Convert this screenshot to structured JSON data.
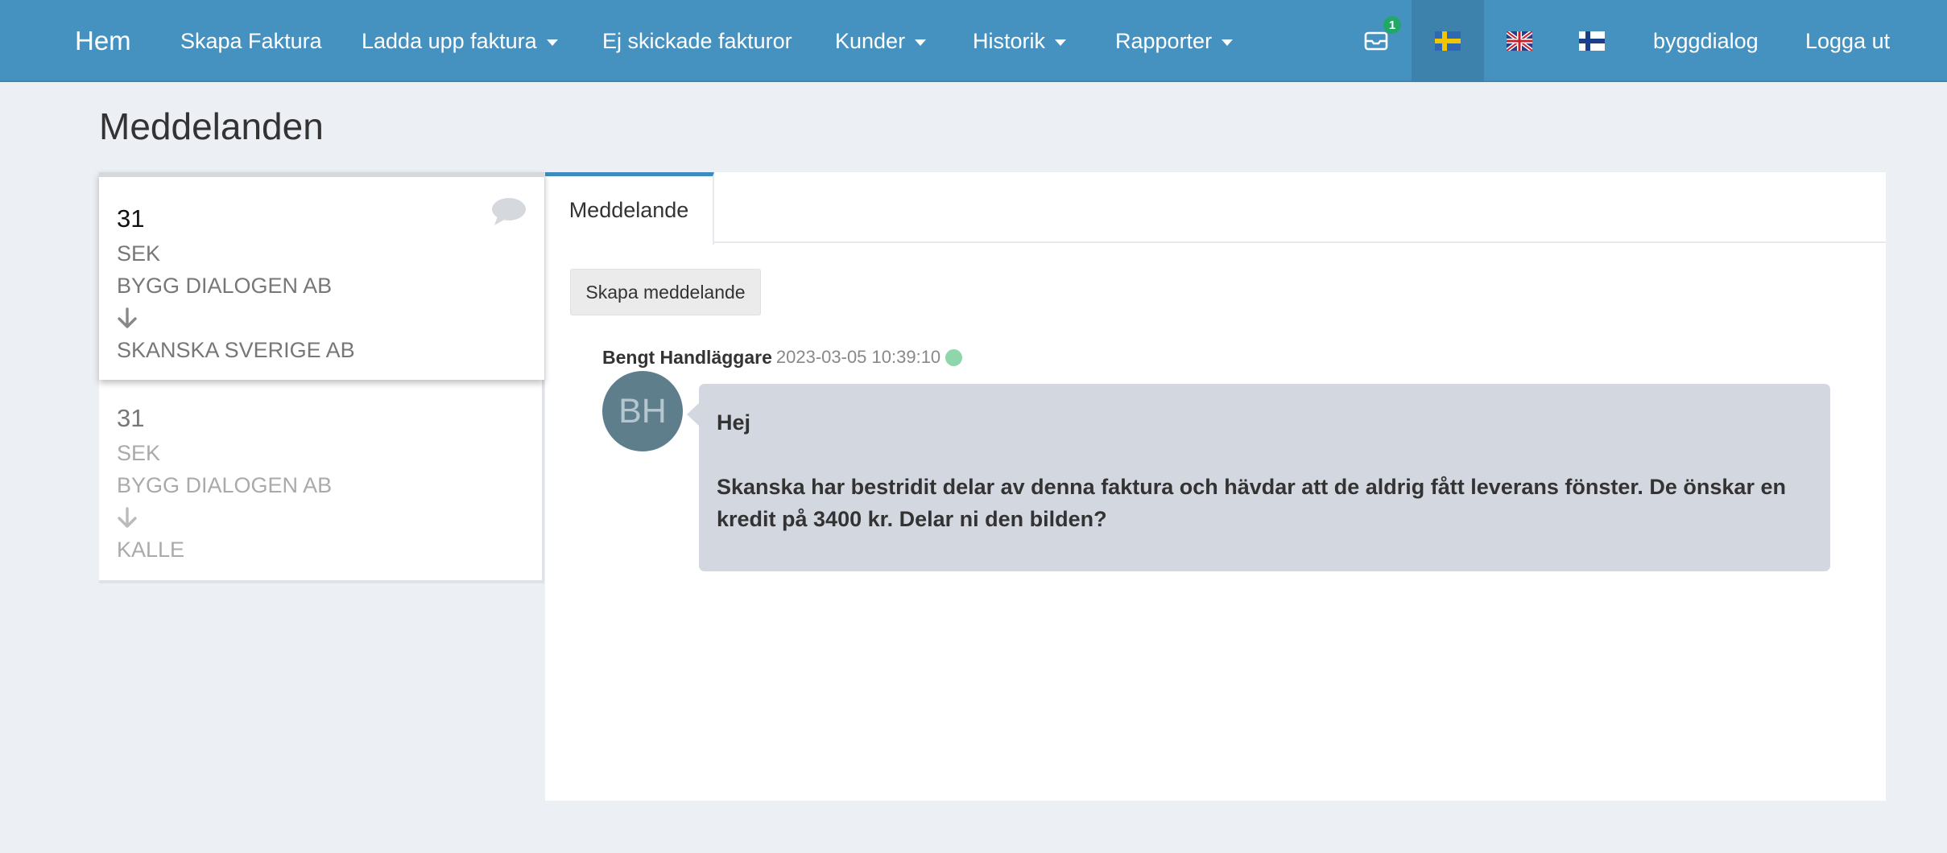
{
  "navbar": {
    "brand": "Hem",
    "items": [
      {
        "label": "Skapa Faktura",
        "dropdown": false
      },
      {
        "label": "Ladda upp faktura",
        "dropdown": true
      },
      {
        "label": "Ej skickade fakturor",
        "dropdown": false
      },
      {
        "label": "Kunder",
        "dropdown": true
      },
      {
        "label": "Historik",
        "dropdown": true
      },
      {
        "label": "Rapporter",
        "dropdown": true
      }
    ],
    "mail_badge_count": "1",
    "languages": [
      {
        "icon": "sweden-flag-icon",
        "active": true
      },
      {
        "icon": "uk-flag-icon",
        "active": false
      },
      {
        "icon": "finland-flag-icon",
        "active": false
      }
    ],
    "user": "byggdialog",
    "logout": "Logga ut",
    "colors": {
      "background": "#4592c0",
      "active_cell": "#3d82ad"
    }
  },
  "page": {
    "title": "Meddelanden"
  },
  "threads": [
    {
      "number": "31",
      "currency": "SEK",
      "sender": "BYGG DIALOGEN AB",
      "receiver": "SKANSKA SVERIGE AB",
      "selected": true,
      "icon": "comment-icon"
    },
    {
      "number": "31",
      "currency": "SEK",
      "sender": "BYGG DIALOGEN AB",
      "receiver": "KALLE",
      "selected": false
    }
  ],
  "panel": {
    "tab_label": "Meddelande",
    "create_button": "Skapa meddelande",
    "message": {
      "author": "Bengt Handläggare",
      "timestamp": "2023-03-05 10:39:10",
      "avatar_initials": "BH",
      "greeting": "Hej",
      "body": "Skanska har bestridit delar av denna faktura och hävdar att de aldrig fått leverans fönster. De önskar en kredit på 3400 kr. Delar ni den bilden?"
    }
  }
}
